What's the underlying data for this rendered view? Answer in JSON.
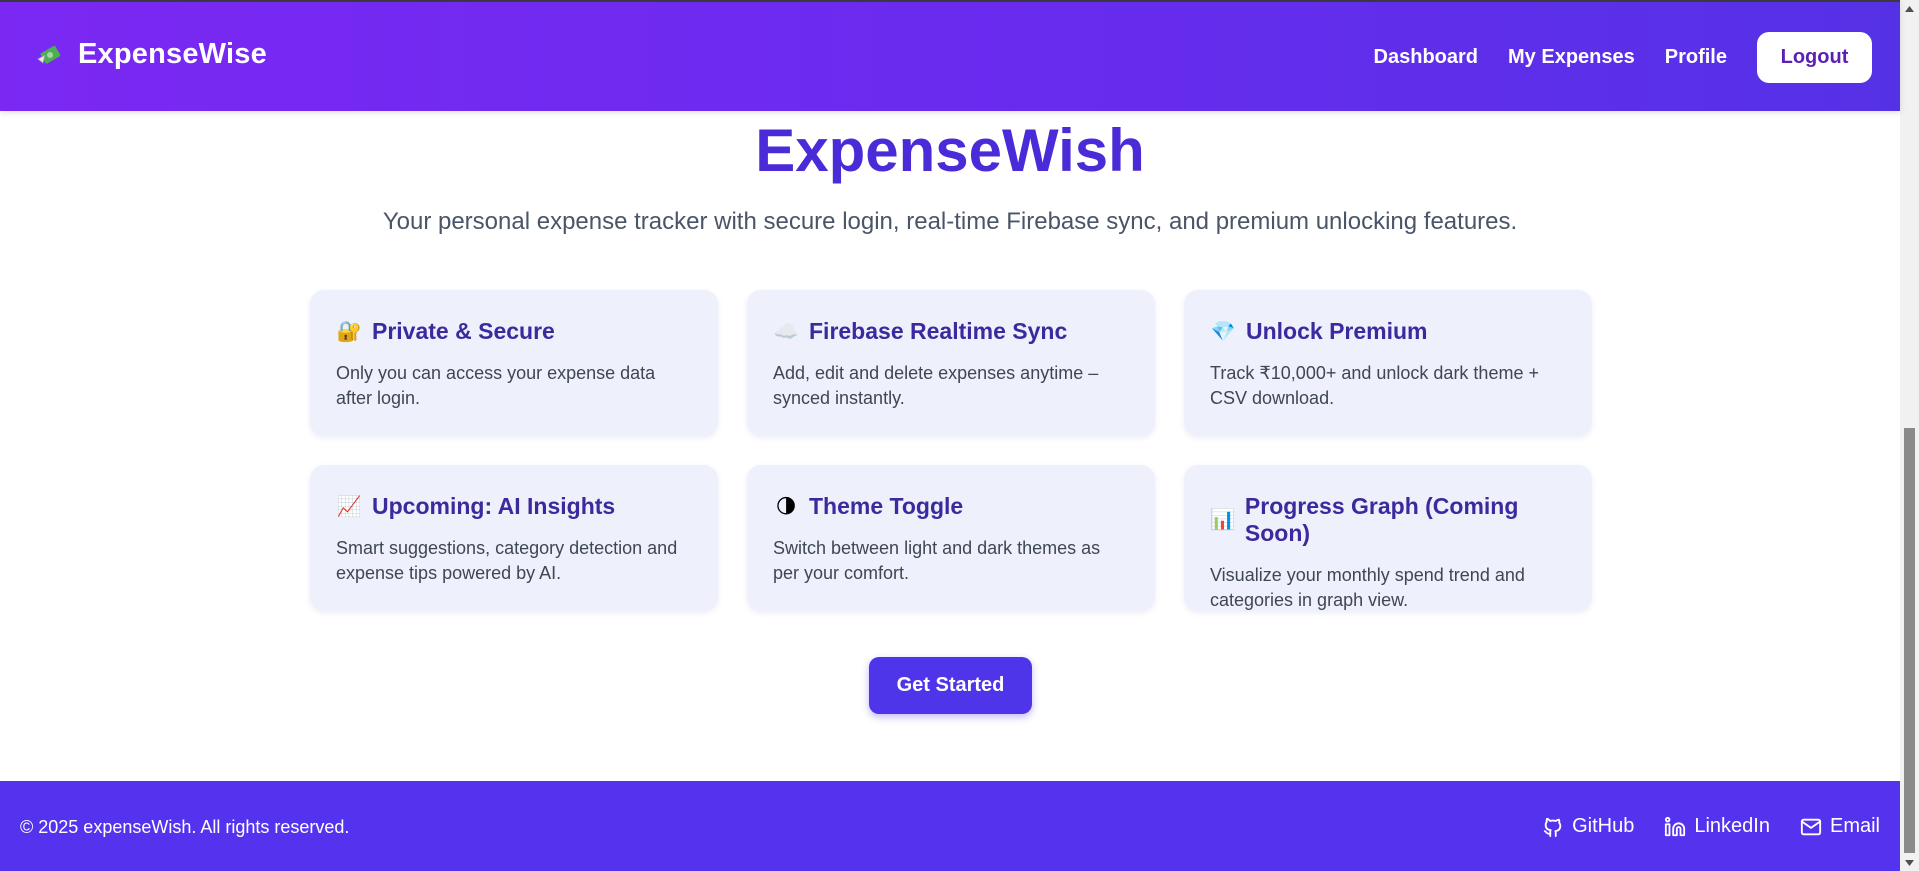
{
  "header": {
    "brand": "ExpenseWise",
    "nav": [
      "Dashboard",
      "My Expenses",
      "Profile"
    ],
    "logout": "Logout"
  },
  "hero": {
    "title": "ExpenseWish",
    "subtitle": "Your personal expense tracker with secure login, real-time Firebase sync, and premium unlocking features."
  },
  "features": [
    {
      "icon": "lock-icon",
      "emoji": "🔐",
      "title": "Private & Secure",
      "text": "Only you can access your expense data after login."
    },
    {
      "icon": "cloud-icon",
      "emoji": "☁️",
      "title": "Firebase Realtime Sync",
      "text": "Add, edit and delete expenses anytime – synced instantly."
    },
    {
      "icon": "gem-icon",
      "emoji": "💎",
      "title": "Unlock Premium",
      "text": "Track ₹10,000+ and unlock dark theme + CSV download."
    },
    {
      "icon": "chart-increasing-icon",
      "emoji": "📈",
      "title": "Upcoming: AI Insights",
      "text": "Smart suggestions, category detection and expense tips powered by AI."
    },
    {
      "icon": "theme-toggle-icon",
      "emoji": "🌗",
      "title": "Theme Toggle",
      "text": "Switch between light and dark themes as per your comfort."
    },
    {
      "icon": "bar-chart-icon",
      "emoji": "📊",
      "title": "Progress Graph (Coming Soon)",
      "text": "Visualize your monthly spend trend and categories in graph view."
    }
  ],
  "cta": {
    "label": "Get Started"
  },
  "footer": {
    "copyright": "© 2025 expenseWish. All rights reserved.",
    "links": [
      "GitHub",
      "LinkedIn",
      "Email"
    ]
  },
  "colors": {
    "header_gradient_start": "#7b28f3",
    "header_gradient_end": "#5531e6",
    "accent": "#4f35e9",
    "title": "#4b2bd8",
    "card_bg": "#eef0fc",
    "footer_bg": "#5533ee"
  }
}
